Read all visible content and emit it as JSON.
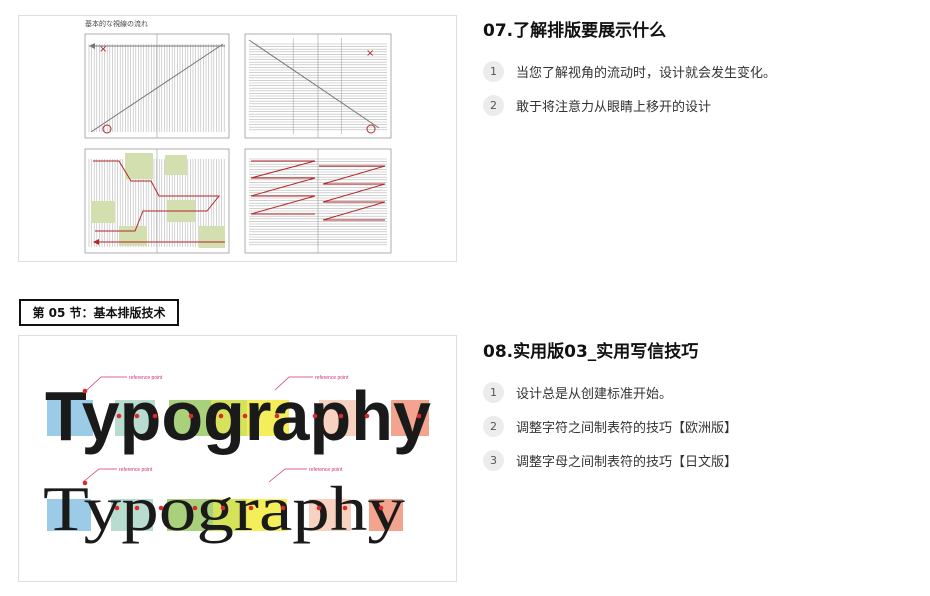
{
  "lesson_07": {
    "figure": {
      "caption": "基本的な視線の流れ"
    },
    "title": "07.了解排版要展示什么",
    "items": [
      {
        "num": "1",
        "text": "当您了解视角的流动时，设计就会发生变化。"
      },
      {
        "num": "2",
        "text": "敢于将注意力从眼睛上移开的设计"
      }
    ]
  },
  "section": {
    "label": "第 05 节：基本排版技术"
  },
  "lesson_08": {
    "figure": {
      "word": "Typography",
      "annotation": "reference point"
    },
    "title": "08.实用版03_实用写信技巧",
    "items": [
      {
        "num": "1",
        "text": "设计总是从创建标准开始。"
      },
      {
        "num": "2",
        "text": "调整字符之间制表符的技巧【欧洲版】"
      },
      {
        "num": "3",
        "text": "调整字母之间制表符的技巧【日文版】"
      }
    ]
  },
  "colors": {
    "accent_red": "#b3262a",
    "pink_label": "#d0307a",
    "green_box": "#d3dfae",
    "highlight_blue": "#9ccbe8",
    "highlight_green": "#a9d07a",
    "highlight_yellow": "#f3ee5a",
    "highlight_salmon": "#f2a48e"
  }
}
